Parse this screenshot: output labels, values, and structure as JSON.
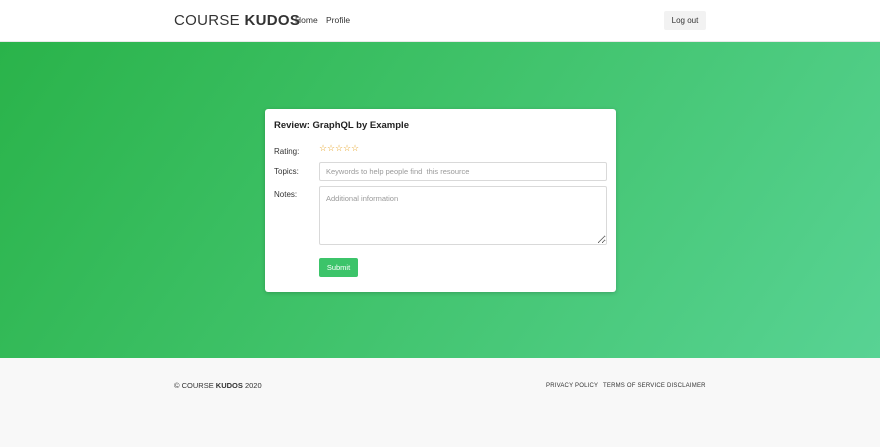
{
  "navbar": {
    "brand_light": "COURSE ",
    "brand_bold": "KUDOS",
    "links": [
      {
        "label": "Home"
      },
      {
        "label": "Profile"
      }
    ],
    "logout_label": "Log out"
  },
  "review_form": {
    "title": "Review: GraphQL by Example",
    "rating_label": "Rating:",
    "rating": {
      "value": 0,
      "max": 5,
      "star_glyph": "☆",
      "star_color": "#e6a52b"
    },
    "topics_label": "Topics:",
    "topics_value": "",
    "topics_placeholder": "Keywords to help people find  this resource",
    "notes_label": "Notes:",
    "notes_value": "",
    "notes_placeholder": "Additional information",
    "submit_label": "Submit"
  },
  "footer": {
    "copyright_prefix": "© COURSE ",
    "copyright_bold": "KUDOS",
    "copyright_year": " 2020",
    "links": [
      {
        "label": "PRIVACY POLICY"
      },
      {
        "label": "TERMS OF SERVICE"
      },
      {
        "label": "DISCLAIMER"
      }
    ]
  },
  "colors": {
    "accent": "#3cc46a",
    "hero_gradient_start": "#2ab34a",
    "hero_gradient_end": "#58d394"
  }
}
